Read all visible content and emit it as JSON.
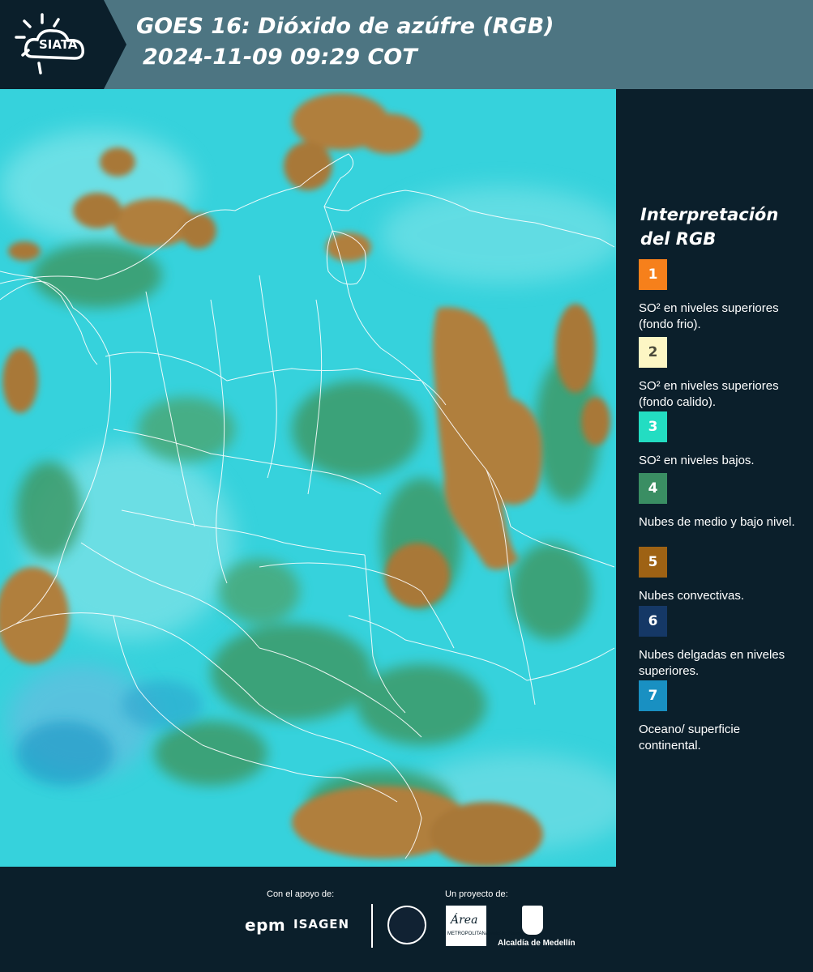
{
  "header": {
    "logo_text": "SIATA",
    "title_line1": "GOES 16: Dióxido de azúfre (RGB)",
    "title_line2": "2024-11-09 09:29 COT"
  },
  "legend": {
    "title": "Interpretación del RGB",
    "items": [
      {
        "number": "1",
        "color": "#f6801b",
        "number_color": "#ffffff",
        "text": "SO² en niveles superiores (fondo frio)."
      },
      {
        "number": "2",
        "color": "#fdf6c4",
        "number_color": "#4a4a3a",
        "text": "SO² en niveles superiores (fondo calido)."
      },
      {
        "number": "3",
        "color": "#23ddc2",
        "number_color": "#ffffff",
        "text": "SO² en niveles bajos."
      },
      {
        "number": "4",
        "color": "#3a8e63",
        "number_color": "#ffffff",
        "text": "Nubes de medio y bajo nivel."
      },
      {
        "number": "5",
        "color": "#9e6214",
        "number_color": "#ffffff",
        "text": "Nubes convectivas."
      },
      {
        "number": "6",
        "color": "#153866",
        "number_color": "#ffffff",
        "text": "Nubes delgadas en niveles superiores."
      },
      {
        "number": "7",
        "color": "#1990c2",
        "number_color": "#ffffff",
        "text": "Oceano/ superficie continental."
      }
    ]
  },
  "footer": {
    "support_label": "Con el apoyo de:",
    "project_label": "Un proyecto de:",
    "sponsor_epm": "epm",
    "sponsor_isagen": "ISAGEN",
    "area_word": "Área",
    "area_sub": "METROPOLITANA Valle de Aburrá",
    "alcaldia": "Alcaldía de Medellín"
  },
  "map_colors": {
    "base": "#36d2dc",
    "convective": "#b07f3c",
    "mid_low": "#3c9a68",
    "boundary": "#ffffff"
  }
}
